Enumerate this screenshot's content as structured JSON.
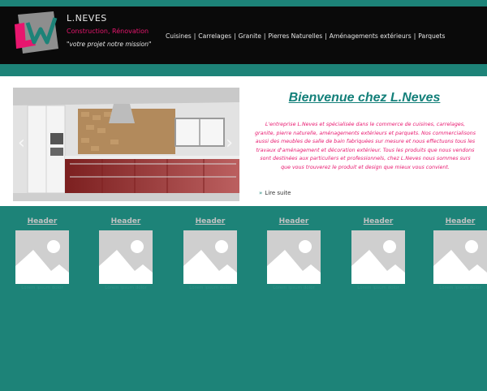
{
  "brand": {
    "name": "L.NEVES",
    "subtitle": "Construction, Rénovation",
    "slogan": "\"votre projet notre mission\""
  },
  "nav": {
    "items": [
      "Cuisines",
      "Carrelages",
      "Granite",
      "Pierres Naturelles",
      "Aménagements extérieurs",
      "Parquets"
    ],
    "separator": "|"
  },
  "hero": {
    "title": "Bienvenue chez L.Neves",
    "description": "L'entreprise L.Neves et spécialisée dans le commerce de cuisines, carrelages, granite, pierre naturelle, aménagements extérieurs et parquets. Nos commercialisons aussi des meubles de salle de bain fabriquées sur mesure et nous effectuons tous les travaux d'aménagement et décoration extérieur. Tous les produits que nous vendons sont destinées aux particuliers et professionnels, chez L.Neves nous sommes surs que vous trouverez le produit et design que mieux vous convient.",
    "read_more": "Lire suite",
    "prev_arrow": "‹",
    "next_arrow": "›"
  },
  "cards": [
    {
      "header": "Header",
      "caption": "Lorem ipsum dolor"
    },
    {
      "header": "Header",
      "caption": "Lorem ipsum dolor"
    },
    {
      "header": "Header",
      "caption": "Lorem ipsum dolor"
    },
    {
      "header": "Header",
      "caption": "Lorem ipsum dolor"
    },
    {
      "header": "Header",
      "caption": "Lorem ipsum dolor"
    },
    {
      "header": "Header",
      "caption": "Lorem ipsum dolor"
    }
  ],
  "colors": {
    "teal": "#1d8378",
    "pink": "#e8166e",
    "black": "#0a0a0a"
  },
  "icons": {
    "logo": "ln-logo-icon",
    "placeholder": "image-placeholder-icon"
  }
}
